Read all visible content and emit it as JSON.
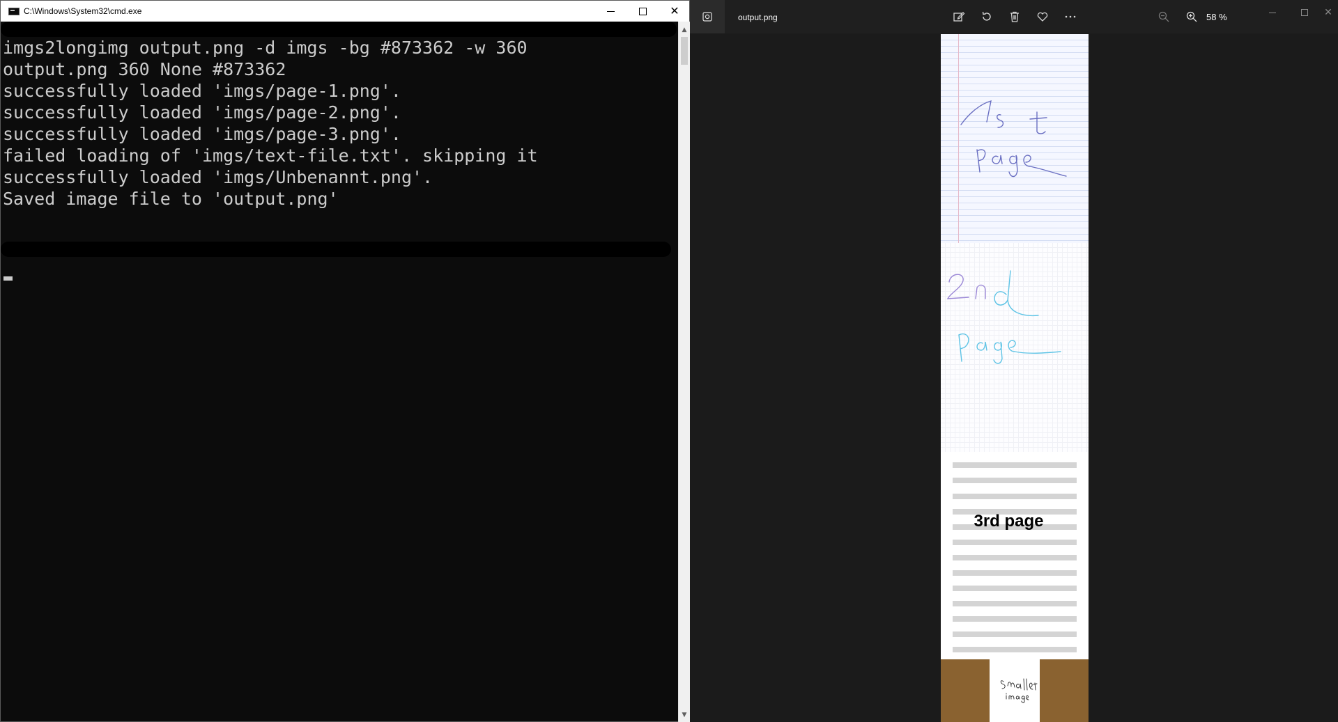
{
  "cmd": {
    "title": "C:\\Windows\\System32\\cmd.exe",
    "lines": [
      "imgs2longimg output.png -d imgs -bg #873362 -w 360",
      "output.png 360 None #873362",
      "successfully loaded 'imgs/page-1.png'.",
      "successfully loaded 'imgs/page-2.png'.",
      "successfully loaded 'imgs/page-3.png'.",
      "failed loading of 'imgs/text-file.txt'. skipping it",
      "successfully loaded 'imgs/Unbenannt.png'.",
      "Saved image file to 'output.png'"
    ]
  },
  "photos": {
    "file_name": "output.png",
    "zoom": "58 %",
    "toolbar_icons": [
      "edit-icon",
      "rotate-icon",
      "delete-icon",
      "favorite-icon",
      "more-icon",
      "zoom-out-icon",
      "zoom-in-icon"
    ],
    "image": {
      "page1_text": "1st page",
      "page2_text": "2nd page",
      "page3_text": "3rd page",
      "page4_text": "smaller image"
    }
  }
}
